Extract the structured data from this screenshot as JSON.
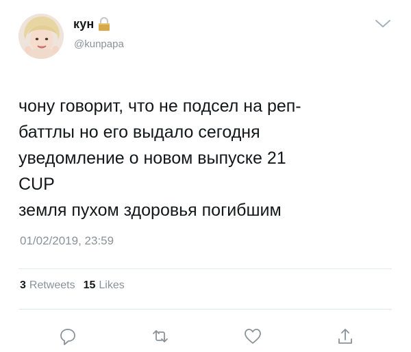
{
  "user": {
    "display_name": "кун",
    "handle": "@kunpapa",
    "protected_icon": "lock-icon"
  },
  "tweet": {
    "text": "чону говорит, что не подсел на реп-\nбаттлы но его выдало сегодня\nуведомление о новом выпуске 21\nCUP\nземля пухом здоровья погибшим",
    "timestamp": "01/02/2019, 23:59"
  },
  "stats": {
    "retweets_count": "3",
    "retweets_label": "Retweets",
    "likes_count": "15",
    "likes_label": "Likes"
  },
  "actions": [
    "reply-icon",
    "retweet-icon",
    "like-icon",
    "share-icon"
  ],
  "colors": {
    "text_primary": "#14171a",
    "text_secondary": "#8a9299",
    "divider": "#e1e8ed",
    "lock": "#d8a94a"
  }
}
